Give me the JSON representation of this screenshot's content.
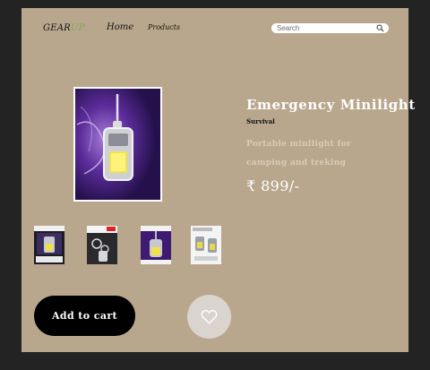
{
  "nav": {
    "logo_main": "GEAR",
    "logo_accent": "UP.",
    "home_label": "Home",
    "products_label": "Products",
    "search_placeholder": "Search"
  },
  "product": {
    "name": "Emergency Minilight",
    "category": "Survival",
    "description": "Portable minilight for camping and treking",
    "price": "₹ 899/-"
  },
  "actions": {
    "add_to_cart_label": "Add to cart"
  },
  "icons": {
    "search": "search-icon",
    "wishlist": "heart-icon"
  },
  "colors": {
    "panel": "#b9a78d",
    "background": "#232323",
    "logo_accent": "#7ea84a",
    "button": "#000000"
  }
}
